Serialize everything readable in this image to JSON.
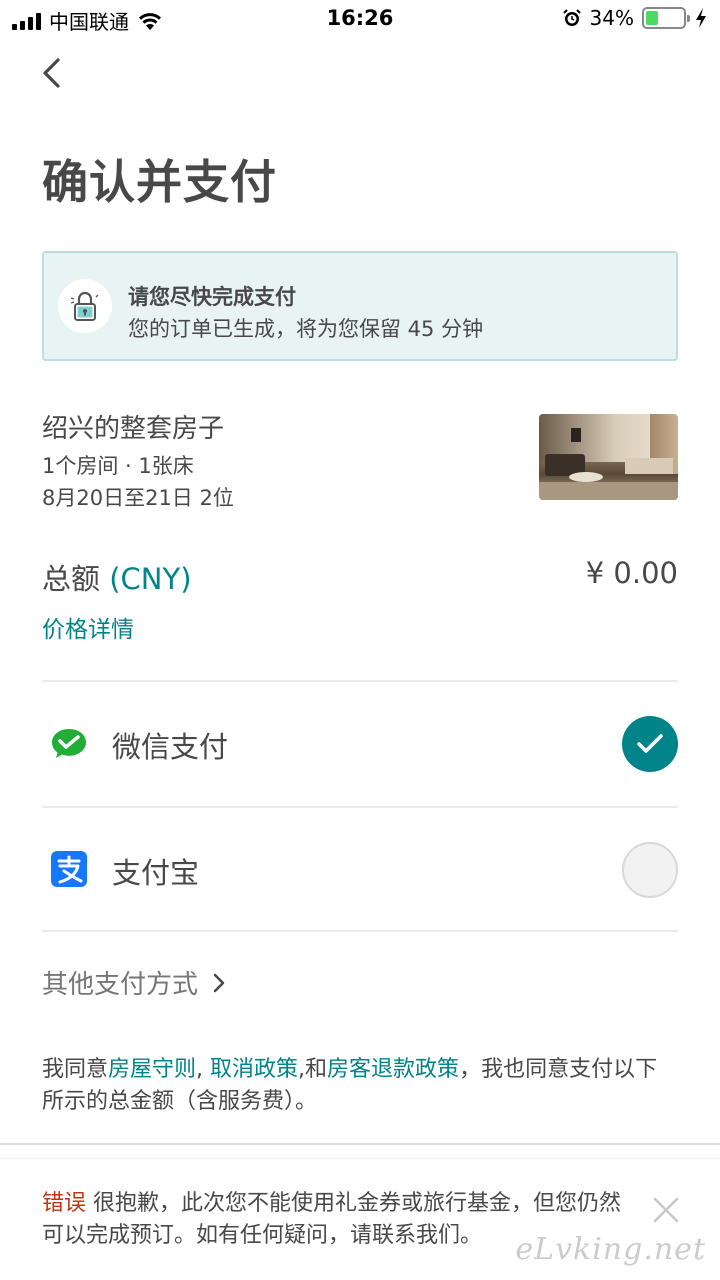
{
  "status_bar": {
    "carrier": "中国联通",
    "time": "16:26",
    "battery_percent": "34%",
    "battery_level": 0.34
  },
  "page": {
    "title": "确认并支付"
  },
  "notice": {
    "title": "请您尽快完成支付",
    "subtitle": "您的订单已生成，将为您保留 45 分钟",
    "icon": "lock-icon"
  },
  "listing": {
    "name": "绍兴的整套房子",
    "rooms": "1个房间 · 1张床",
    "dates": "8月20日至21日  2位"
  },
  "total": {
    "label": "总额 ",
    "currency": "(CNY)",
    "amount": "¥ 0.00",
    "details_link": "价格详情"
  },
  "payment_methods": [
    {
      "label": "微信支付",
      "icon": "wechat-pay-icon",
      "selected": true
    },
    {
      "label": "支付宝",
      "icon": "alipay-icon",
      "selected": false
    }
  ],
  "other_payment": "其他支付方式",
  "agreement": {
    "prefix": "我同意",
    "link1": "房屋守则",
    "sep1": ", ",
    "link2": "取消政策",
    "sep2": ",和",
    "link3": "房客退款政策",
    "suffix": "，我也同意支付以下所示的总金额（含服务费）。"
  },
  "error_banner": {
    "label": "错误",
    "message": " 很抱歉，此次您不能使用礼金券或旅行基金，但您仍然可以完成预订。如有任何疑问，请联系我们。"
  },
  "watermark": "eLvking.net",
  "colors": {
    "accent": "#008489",
    "error": "#c13515",
    "notice_bg": "#e8f4f4",
    "text": "#484848"
  }
}
